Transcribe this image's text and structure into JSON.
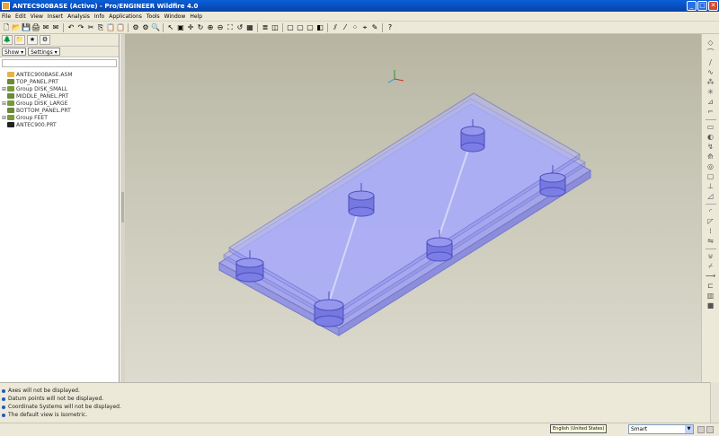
{
  "window": {
    "title": "ANTEC900BASE (Active) - Pro/ENGINEER Wildfire 4.0",
    "minimize": "_",
    "maximize": "□",
    "close": "✕"
  },
  "menu": [
    "File",
    "Edit",
    "View",
    "Insert",
    "Analysis",
    "Info",
    "Applications",
    "Tools",
    "Window",
    "Help"
  ],
  "toolbar": {
    "icons": [
      "new-icon",
      "open-icon",
      "save-icon",
      "print-icon",
      "email-icon",
      "email-link-icon",
      "undo-icon",
      "redo-icon",
      "cut-icon",
      "copy-icon",
      "paste-icon",
      "paste-special-icon",
      "regenerate-icon",
      "regen-manager-icon",
      "find-icon",
      "select-icon",
      "repaint-icon",
      "spin-center-icon",
      "orient-icon",
      "zoom-in-icon",
      "zoom-out-icon",
      "refit-icon",
      "reorient-icon",
      "saved-views-icon",
      "layers-icon",
      "view-manager-icon",
      "wireframe-icon",
      "hidden-line-icon",
      "no-hidden-icon",
      "shading-icon",
      "datum-planes-icon",
      "datum-axes-icon",
      "datum-points-icon",
      "coord-sys-icon",
      "annotations-icon",
      "whats-this-icon"
    ],
    "glyphs": [
      "🗋",
      "📂",
      "💾",
      "🖨",
      "✉",
      "✉",
      "↶",
      "↷",
      "✂",
      "⎘",
      "📋",
      "📋",
      "⚙",
      "⚙",
      "🔍",
      "↖",
      "▣",
      "✛",
      "↻",
      "⊕",
      "⊖",
      "⛶",
      "↺",
      "▦",
      "≣",
      "◫",
      "▢",
      "▢",
      "▢",
      "◧",
      "⫽",
      "⁄",
      "⁘",
      "⌖",
      "✎",
      "?"
    ]
  },
  "model_tree": {
    "show_menu": "Show ▾",
    "settings_menu": "Settings ▾",
    "items": [
      {
        "label": "ANTEC900BASE.ASM",
        "expander": "",
        "color": "#e1b34a"
      },
      {
        "label": "TOP_PANEL.PRT",
        "expander": "",
        "color": "#6a8a3a"
      },
      {
        "label": "Group DISK_SMALL",
        "expander": "⊞",
        "color": "#7a9a3a"
      },
      {
        "label": "MIDDLE_PANEL.PRT",
        "expander": "",
        "color": "#6a8a3a"
      },
      {
        "label": "Group DISK_LARGE",
        "expander": "⊞",
        "color": "#7a9a3a"
      },
      {
        "label": "BOTTOM_PANEL.PRT",
        "expander": "",
        "color": "#6a8a3a"
      },
      {
        "label": "Group FEET",
        "expander": "⊞",
        "color": "#7a9a3a"
      },
      {
        "label": "ANTEC900.PRT",
        "expander": "",
        "color": "#222222"
      }
    ]
  },
  "right_toolbar": {
    "icons": [
      "sketch-icon",
      "edge-icon",
      "curve-icon",
      "datum-curve-icon",
      "datum-point-icon",
      "coord-icon",
      "analysis-icon",
      "csys-icon",
      "extrude-icon",
      "revolve-icon",
      "sweep-icon",
      "blend-icon",
      "hole-icon",
      "shell-icon",
      "rib-icon",
      "draft-icon",
      "round-icon",
      "chamfer-icon",
      "pattern-icon",
      "mirror-icon",
      "merge-icon",
      "trim-icon",
      "extend-icon",
      "offset-icon",
      "thicken-icon",
      "solidify-icon"
    ],
    "glyphs": [
      "◇",
      "⌒",
      "∕",
      "∿",
      "⁂",
      "✳",
      "⊿",
      "⌐",
      "▭",
      "◐",
      "↯",
      "⟰",
      "◎",
      "▢",
      "⊥",
      "◿",
      "◜",
      "◸",
      "⁞",
      "⇋",
      "⊎",
      "⌿",
      "⟶",
      "⊏",
      "▥",
      "■"
    ]
  },
  "messages": [
    "Axes will not be displayed.",
    "Datum points will not be displayed.",
    "Coordinate Systems will not be displayed.",
    "The default view is isometric."
  ],
  "status": {
    "tooltip": "English (United States)",
    "filter_value": "Smart"
  },
  "colors": {
    "accent": "#0a5fd8",
    "model_fill": "#8c8ef0",
    "model_edge": "#5a5cc8",
    "viewport_top": "#b7b5a2",
    "viewport_bottom": "#dcdbce"
  }
}
